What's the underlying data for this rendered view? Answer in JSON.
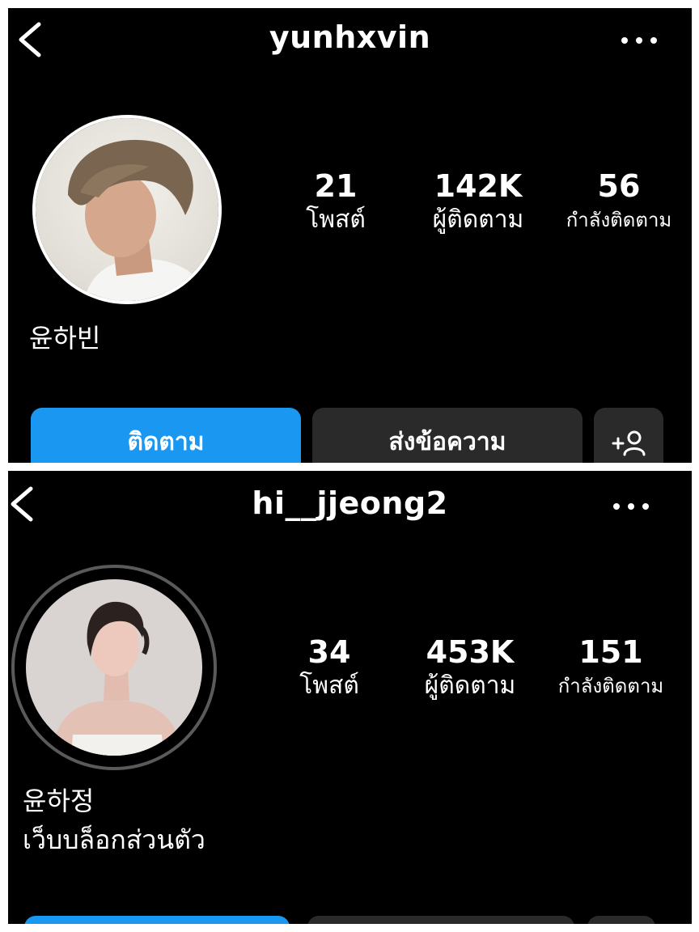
{
  "profiles": [
    {
      "username": "yunhxvin",
      "name": "윤하빈",
      "bio": "",
      "stats": {
        "posts_count": "21",
        "posts_label": "โพสต์",
        "followers_count": "142K",
        "followers_label": "ผู้ติดตาม",
        "following_count": "56",
        "following_label": "กำลังติดตาม"
      },
      "buttons": {
        "follow": "ติดตาม",
        "message": "ส่งข้อความ",
        "suggest": "+👤"
      }
    },
    {
      "username": "hi__jjeong2",
      "name": "윤하정",
      "bio": "เว็บบล็อกส่วนตัว",
      "stats": {
        "posts_count": "34",
        "posts_label": "โพสต์",
        "followers_count": "453K",
        "followers_label": "ผู้ติดตาม",
        "following_count": "151",
        "following_label": "กำลังติดตาม"
      }
    }
  ],
  "theme": {
    "background": "#000000",
    "follow_button": "#1a97f0",
    "secondary_button": "#2a2a2a",
    "text": "#ffffff"
  },
  "icons": [
    "back-chevron-icon",
    "more-options-icon",
    "add-person-icon"
  ]
}
